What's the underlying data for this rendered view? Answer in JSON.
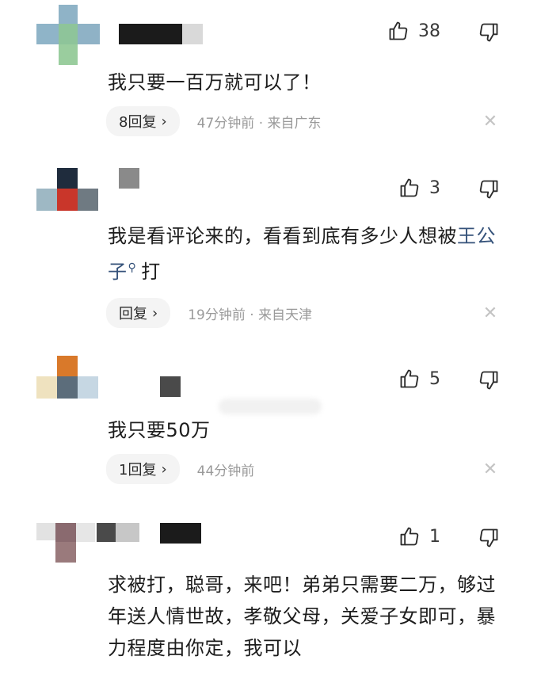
{
  "comments": [
    {
      "likes": "38",
      "text": "我只要一百万就可以了！",
      "reply_label": "8回复",
      "meta": "47分钟前 · 来自广东"
    },
    {
      "likes": "3",
      "text_before": "我是看评论来的，看看到底有多少人想被",
      "mention": "王公子",
      "text_after": "打",
      "reply_label": "回复",
      "meta": "19分钟前 · 来自天津"
    },
    {
      "likes": "5",
      "text": "我只要50万",
      "reply_label": "1回复",
      "meta": "44分钟前"
    },
    {
      "likes": "1",
      "text": "求被打，聪哥，来吧！弟弟只需要二万，够过年送人情世故，孝敬父母，关爱子女即可，暴力程度由你定，我可以"
    }
  ],
  "icons": {
    "like": "thumbs-up-icon",
    "dislike": "thumbs-down-icon",
    "close": "close-icon",
    "chevron": "chevron-right-icon",
    "mention": "search-icon"
  },
  "colors": {
    "mention": "#35527a",
    "meta": "#9a9a9a",
    "pill_bg": "#f4f4f4"
  },
  "ui": {
    "chevron_glyph": "›",
    "close_glyph": "✕"
  }
}
